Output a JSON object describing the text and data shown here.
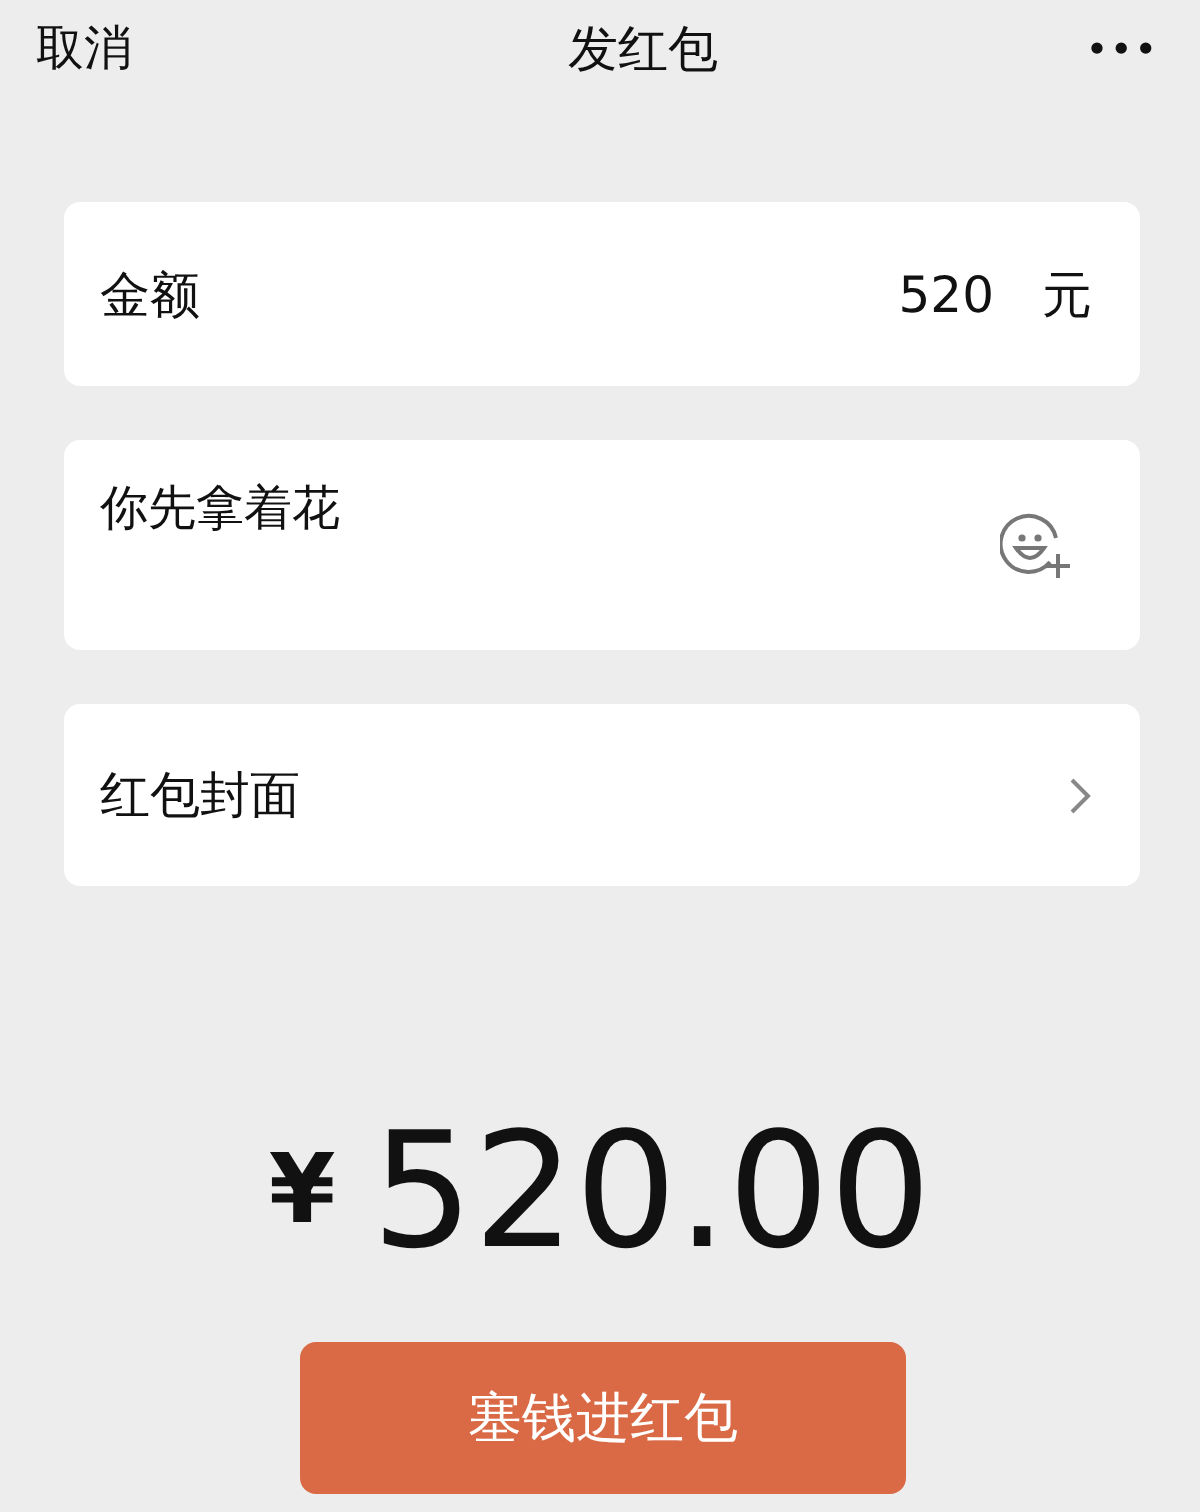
{
  "nav": {
    "cancel": "取消",
    "title": "发红包",
    "more": "•••"
  },
  "amount": {
    "label": "金额",
    "value": "520",
    "unit": "元"
  },
  "message": {
    "value": "你先拿着花"
  },
  "cover": {
    "label": "红包封面"
  },
  "total": {
    "currency": "¥",
    "value": "520.00"
  },
  "submit": {
    "label": "塞钱进红包"
  }
}
